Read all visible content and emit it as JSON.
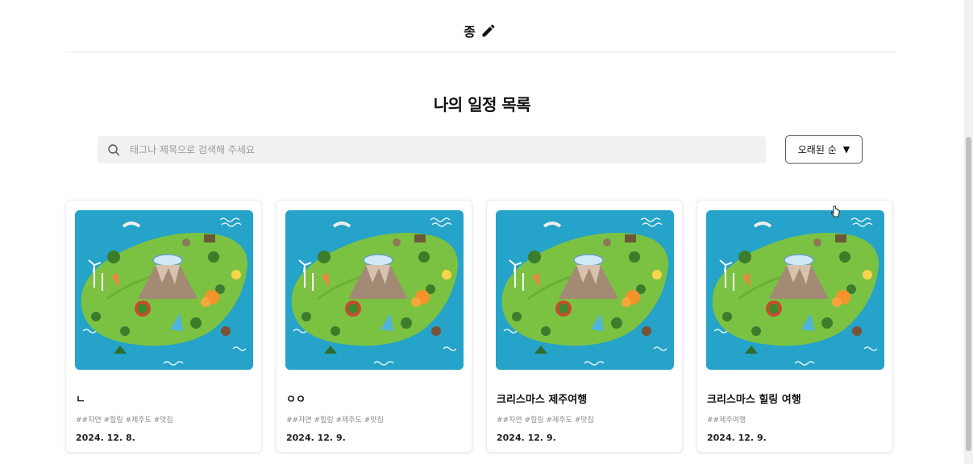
{
  "header": {
    "username": "종",
    "edit_icon": "pencil-icon"
  },
  "page_title": "나의 일정 목록",
  "search": {
    "placeholder": "태그나 제목으로 검색해 주세요",
    "value": "",
    "icon": "search-icon"
  },
  "sort": {
    "label": "오래된 순",
    "caret": "▼"
  },
  "colors": {
    "sea": "#25a3c8",
    "land": "#7cc242",
    "card_border": "#ececec",
    "tag_text": "#8a8a8a"
  },
  "cards": [
    {
      "title": "ㄴ",
      "tags": "##자연 #힐링 #제주도 #맛집",
      "date": "2024. 12. 8."
    },
    {
      "title": "ㅇㅇ",
      "tags": "##자연 #힐링 #제주도 #맛집",
      "date": "2024. 12. 9."
    },
    {
      "title": "크리스마스 제주여행",
      "tags": "##자연 #힐링 #제주도 #맛집",
      "date": "2024. 12. 9."
    },
    {
      "title": "크리스마스 힐링 여행",
      "tags": "##제주여행",
      "date": "2024. 12. 9."
    }
  ]
}
